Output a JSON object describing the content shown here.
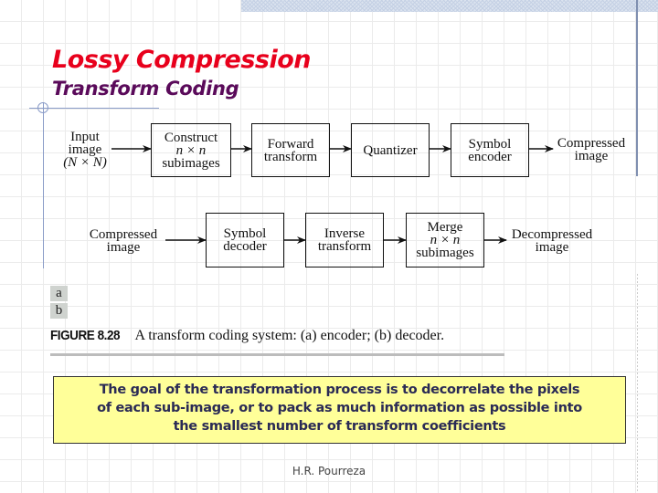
{
  "slide": {
    "title": "Lossy Compression",
    "subtitle": "Transform Coding",
    "colors": {
      "title": "#e8001c",
      "subtitle": "#5a0a5a",
      "note_bg": "#ffff99",
      "note_text": "#2a2a55"
    }
  },
  "diagram": {
    "encoder": {
      "input_label": [
        "Input",
        "image",
        "(N × N)"
      ],
      "blocks": [
        {
          "lines": [
            "Construct",
            "n × n",
            "subimages"
          ]
        },
        {
          "lines": [
            "Forward",
            "transform"
          ]
        },
        {
          "lines": [
            "Quantizer"
          ]
        },
        {
          "lines": [
            "Symbol",
            "encoder"
          ]
        }
      ],
      "output_label": [
        "Compressed",
        "image"
      ]
    },
    "decoder": {
      "input_label": [
        "Compressed",
        "image"
      ],
      "blocks": [
        {
          "lines": [
            "Symbol",
            "decoder"
          ]
        },
        {
          "lines": [
            "Inverse",
            "transform"
          ]
        },
        {
          "lines": [
            "Merge",
            "n × n",
            "subimages"
          ]
        }
      ],
      "output_label": [
        "Decompressed",
        "image"
      ]
    },
    "panel_labels": [
      "a",
      "b"
    ],
    "caption_figure": "FIGURE 8.28",
    "caption_text": "A transform coding system: (a) encoder; (b) decoder."
  },
  "note": {
    "lines": [
      "The goal of the transformation process is to decorrelate the pixels",
      "of each sub-image, or to pack as much information as possible into",
      "the smallest number of transform coefficients"
    ]
  },
  "footer": {
    "author": "H.R. Pourreza"
  }
}
